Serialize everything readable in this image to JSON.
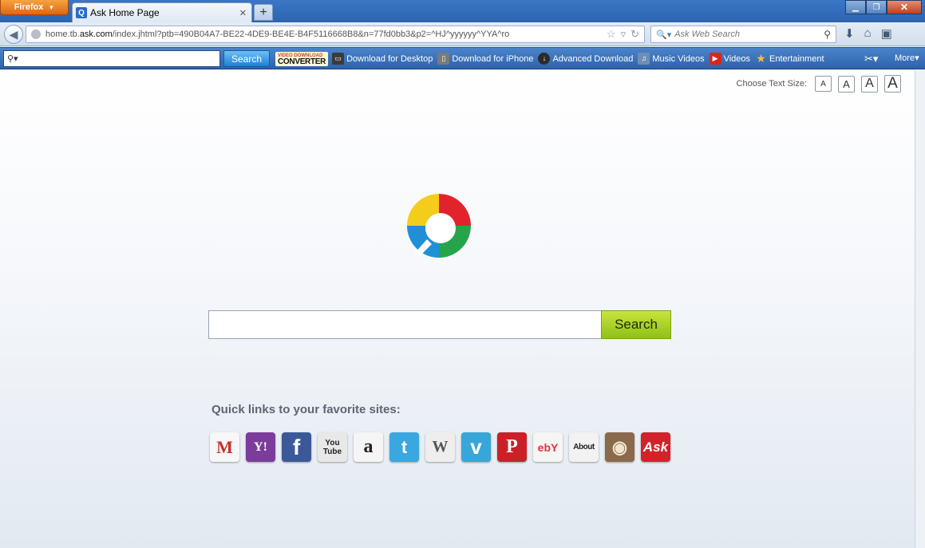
{
  "browser": {
    "menu_label": "Firefox",
    "tab_title": "Ask Home Page",
    "url_prefix": "home.tb.",
    "url_domain": "ask.com",
    "url_rest": "/index.jhtml?ptb=490B04A7-BE22-4DE9-BE4E-B4F5116668B8&n=77fd0bb3&p2=^HJ^yyyyyy^YYA^ro",
    "search_placeholder": "Ask Web Search"
  },
  "toolbar": {
    "search_label": "Search",
    "vdc_top": "VIDEO DOWNLOAD",
    "vdc_bottom": "CONVERTER",
    "items": [
      {
        "label": "Download for Desktop",
        "icon": "monitor-icon",
        "color": "#3b3b3b"
      },
      {
        "label": "Download for iPhone",
        "icon": "phone-icon",
        "color": "#7a7a7a"
      },
      {
        "label": "Advanced Download",
        "icon": "download-icon",
        "color": "#2b2b2b"
      },
      {
        "label": "Music Videos",
        "icon": "music-note-icon",
        "color": "#6c8fb5"
      },
      {
        "label": "Videos",
        "icon": "youtube-icon",
        "color": "#d8261d"
      },
      {
        "label": "Entertainment",
        "icon": "star-icon",
        "color": "#f2c12e"
      }
    ],
    "more_label": "More"
  },
  "page": {
    "text_size_label": "Choose Text Size:",
    "text_size_options": [
      "A",
      "A",
      "A",
      "A"
    ],
    "search_button": "Search",
    "quick_links_title": "Quick links to your favorite sites:",
    "quick_links": [
      {
        "name": "gmail",
        "label": "M",
        "bg": "#f7f7f7",
        "fg": "#c9302c"
      },
      {
        "name": "yahoo",
        "label": "Y!",
        "bg": "#7b3c9b",
        "fg": "#ffffff"
      },
      {
        "name": "facebook",
        "label": "f",
        "bg": "#3b5998",
        "fg": "#ffffff"
      },
      {
        "name": "youtube",
        "label": "You Tube",
        "bg": "#e8e8e8",
        "fg": "#222222"
      },
      {
        "name": "amazon",
        "label": "a",
        "bg": "#f5f5f5",
        "fg": "#222222"
      },
      {
        "name": "twitter",
        "label": "t",
        "bg": "#3aa7e0",
        "fg": "#ffffff"
      },
      {
        "name": "wikipedia",
        "label": "W",
        "bg": "#eeeeee",
        "fg": "#555555"
      },
      {
        "name": "vimeo",
        "label": "v",
        "bg": "#38a6d8",
        "fg": "#ffffff"
      },
      {
        "name": "pinterest",
        "label": "P",
        "bg": "#cb2027",
        "fg": "#ffffff"
      },
      {
        "name": "ebay",
        "label": "ebY",
        "bg": "#f5f5f5",
        "fg": "#e53238"
      },
      {
        "name": "about",
        "label": "About",
        "bg": "#f2f2f2",
        "fg": "#222222"
      },
      {
        "name": "instagram",
        "label": "◉",
        "bg": "#8a6a4a",
        "fg": "#f0e4cf"
      },
      {
        "name": "ask",
        "label": "Ask",
        "bg": "#d2232a",
        "fg": "#ffffff"
      }
    ]
  }
}
